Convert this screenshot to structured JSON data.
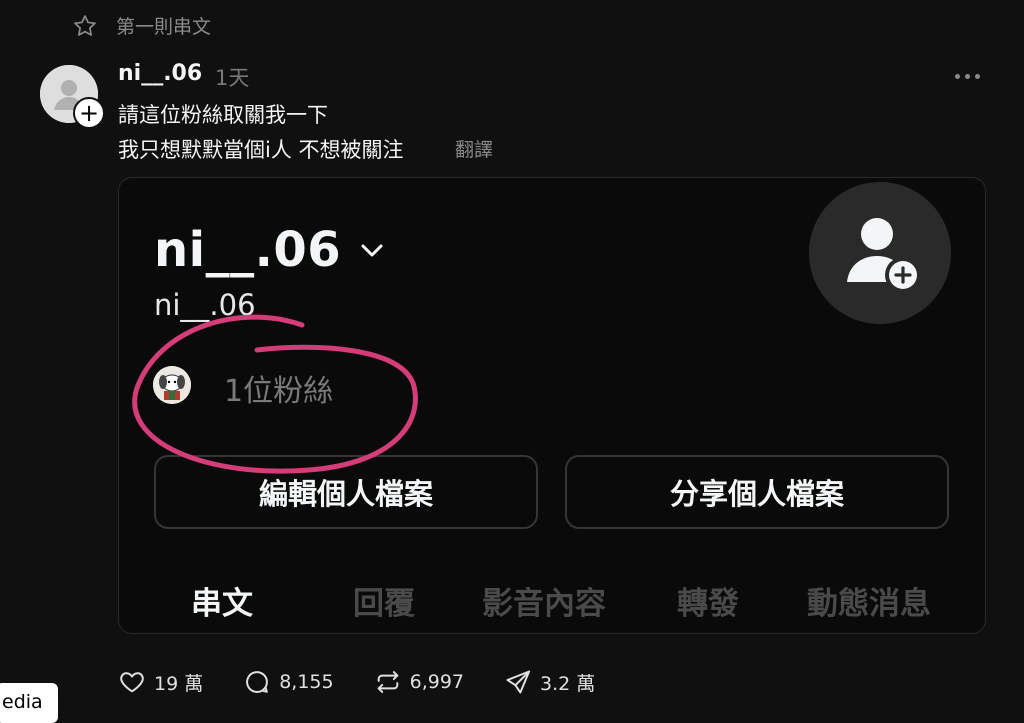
{
  "pinned": {
    "label": "第一則串文"
  },
  "post": {
    "username": "ni__.06",
    "time": "1天",
    "line1": "請這位粉絲取關我一下",
    "line2": "我只想默默當個i人 不想被關注",
    "translate": "翻譯",
    "avatar_plus": "+"
  },
  "embedded_profile": {
    "display_name": "ni__.06",
    "handle": "ni__.06",
    "followers": "1位粉絲",
    "edit_button": "編輯個人檔案",
    "share_button": "分享個人檔案",
    "tabs": [
      {
        "label": "串文",
        "active": true
      },
      {
        "label": "回覆",
        "active": false
      },
      {
        "label": "影音內容",
        "active": false
      },
      {
        "label": "轉發",
        "active": false
      },
      {
        "label": "動態消息",
        "active": false
      }
    ],
    "annotation_color": "#d43d78"
  },
  "actions": {
    "likes": "19 萬",
    "comments": "8,155",
    "reposts": "6,997",
    "shares": "3.2 萬"
  },
  "side_tab": {
    "label": "edia"
  },
  "colors": {
    "background": "#101010",
    "text_primary": "#f3f5f7",
    "text_secondary": "#8a8a8a",
    "annotation": "#d43d78"
  }
}
